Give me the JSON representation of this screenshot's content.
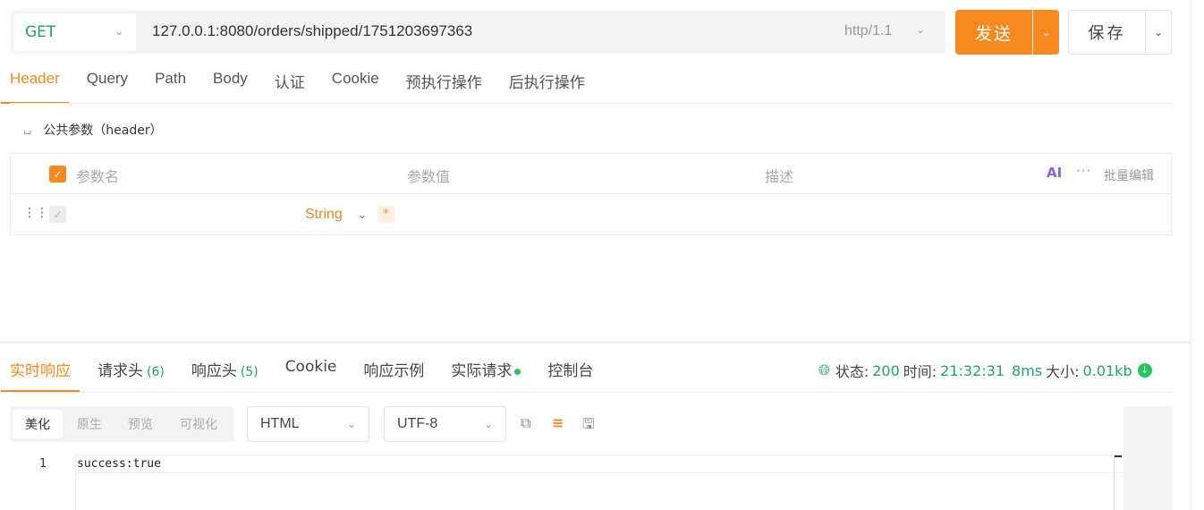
{
  "request": {
    "method": "GET",
    "url": "127.0.0.1:8080/orders/shipped/1751203697363",
    "protocol": "http/1.1",
    "send_label": "发送",
    "save_label": "保存"
  },
  "tabs": [
    "Header",
    "Query",
    "Path",
    "Body",
    "认证",
    "Cookie",
    "预执行操作",
    "后执行操作"
  ],
  "header_section": {
    "title": "公共参数（header）",
    "columns": {
      "name": "参数名",
      "value": "参数值",
      "desc": "描述"
    },
    "ai_label": "AI",
    "more_label": "···",
    "bulk_edit_label": "批量编辑",
    "row": {
      "type": "String",
      "required_mark": "*"
    }
  },
  "response": {
    "tabs": [
      {
        "label": "实时响应",
        "count": ""
      },
      {
        "label": "请求头",
        "count": "(6)"
      },
      {
        "label": "响应头",
        "count": "(5)"
      },
      {
        "label": "Cookie",
        "count": ""
      },
      {
        "label": "响应示例",
        "count": ""
      },
      {
        "label": "实际请求",
        "count": ""
      },
      {
        "label": "控制台",
        "count": ""
      }
    ],
    "status_label": "状态:",
    "status_code": "200",
    "time_label": "时间:",
    "time_value": "21:32:31",
    "duration": "8ms",
    "size_label": "大小:",
    "size_value": "0.01kb",
    "view_modes": [
      "美化",
      "原生",
      "预览",
      "可视化"
    ],
    "format": "HTML",
    "encoding": "UTF-8",
    "line_number": "1",
    "body": "success:true"
  },
  "colors": {
    "accent": "#f7891e",
    "success": "#22a26f"
  }
}
